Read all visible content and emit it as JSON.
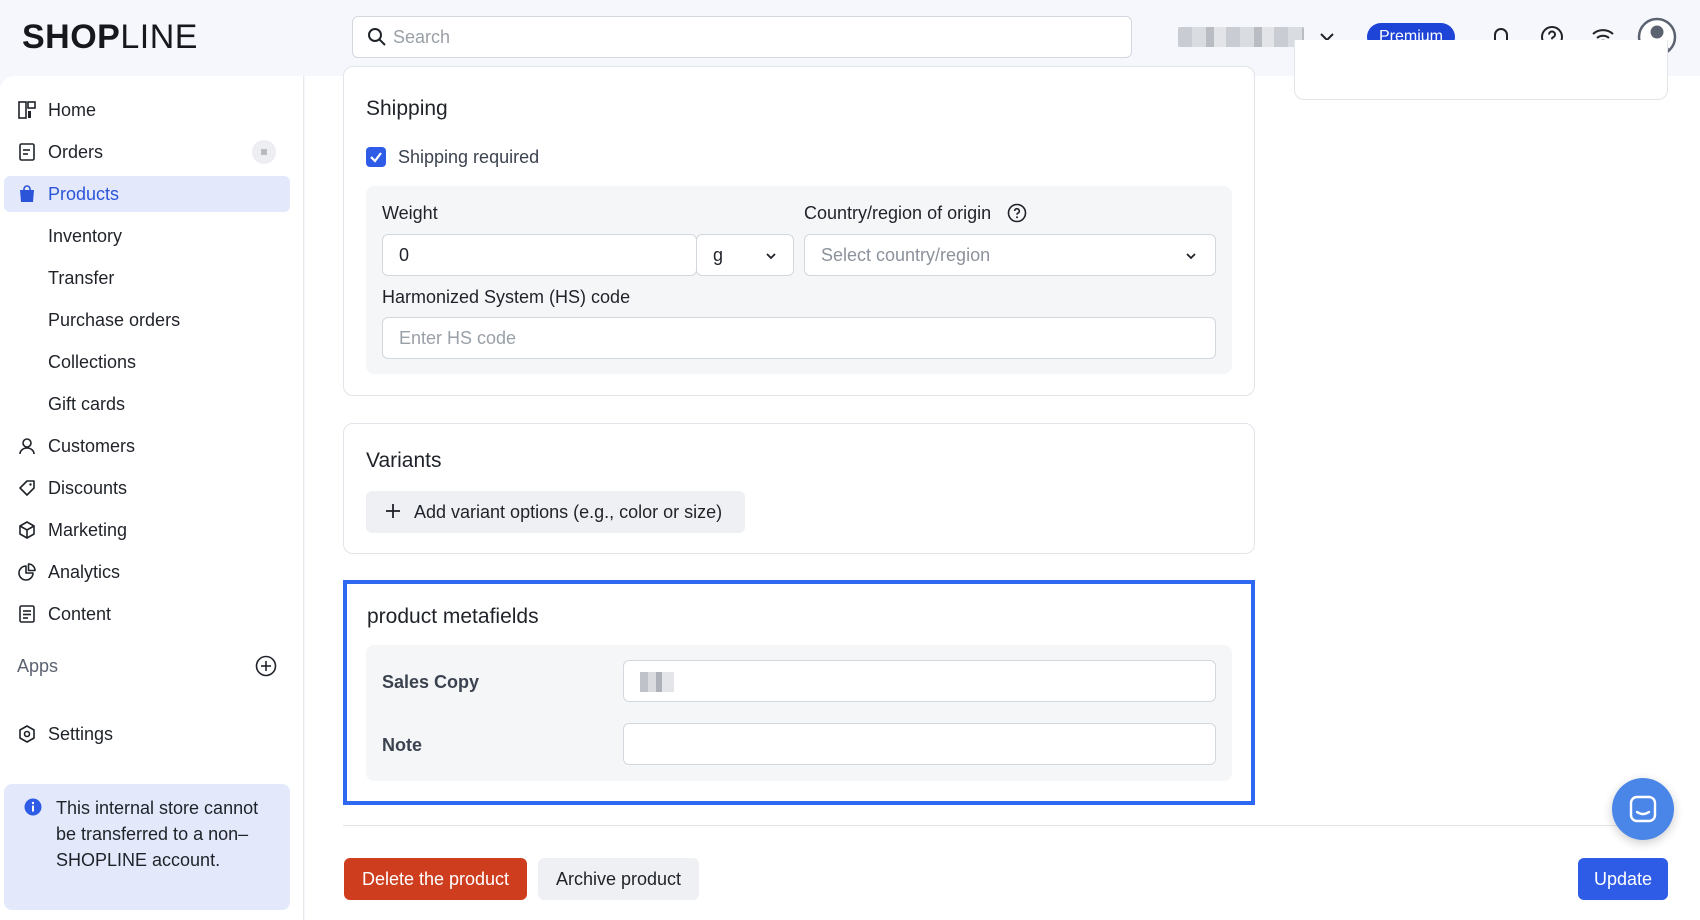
{
  "header": {
    "logo_bold": "SHOP",
    "logo_light": "LINE",
    "search_placeholder": "Search",
    "plan_badge": "Premium"
  },
  "sidebar": {
    "items": [
      {
        "label": "Home",
        "icon": "dashboard-icon"
      },
      {
        "label": "Orders",
        "icon": "orders-icon"
      },
      {
        "label": "Products",
        "icon": "shopping-bag-icon",
        "active": true
      },
      {
        "label": "Inventory"
      },
      {
        "label": "Transfer"
      },
      {
        "label": "Purchase orders"
      },
      {
        "label": "Collections"
      },
      {
        "label": "Gift cards"
      },
      {
        "label": "Customers",
        "icon": "person-icon"
      },
      {
        "label": "Discounts",
        "icon": "tag-icon"
      },
      {
        "label": "Marketing",
        "icon": "cube-icon"
      },
      {
        "label": "Analytics",
        "icon": "pie-chart-icon"
      },
      {
        "label": "Content",
        "icon": "document-icon"
      }
    ],
    "apps_label": "Apps",
    "settings_label": "Settings",
    "info_text": "This internal store cannot be transferred to a non–SHOPLINE account."
  },
  "shipping": {
    "title": "Shipping",
    "checkbox_label": "Shipping required",
    "checkbox_checked": true,
    "weight_label": "Weight",
    "weight_value": "0",
    "weight_unit": "g",
    "origin_label": "Country/region of origin",
    "origin_placeholder": "Select country/region",
    "hs_label": "Harmonized System (HS) code",
    "hs_placeholder": "Enter HS code"
  },
  "variants": {
    "title": "Variants",
    "add_button": "Add variant options (e.g., color or size)"
  },
  "metafields": {
    "title": "product metafields",
    "fields": [
      {
        "label": "Sales Copy"
      },
      {
        "label": "Note"
      }
    ]
  },
  "footer": {
    "delete_label": "Delete the product",
    "archive_label": "Archive product",
    "update_label": "Update"
  },
  "colors": {
    "accent": "#2e5ce6",
    "premium": "#1d44d6",
    "danger": "#cf3d1f",
    "highlight": "#2e67f0",
    "active_nav_bg": "#e3e9fb"
  }
}
